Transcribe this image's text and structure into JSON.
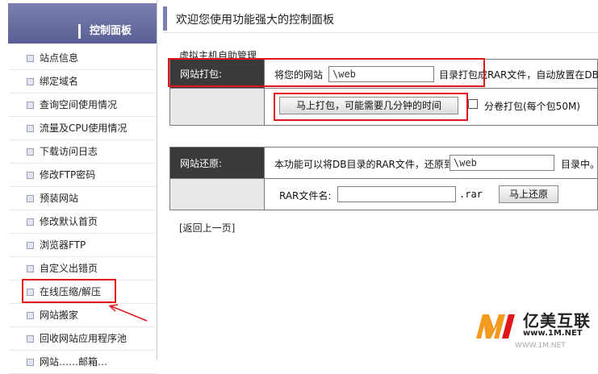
{
  "sidebar": {
    "title": "控制面板",
    "items": [
      {
        "label": "站点信息"
      },
      {
        "label": "绑定域名"
      },
      {
        "label": "查询空间使用情况"
      },
      {
        "label": "流量及CPU使用情况"
      },
      {
        "label": "下载访问日志"
      },
      {
        "label": "修改FTP密码"
      },
      {
        "label": "预装网站"
      },
      {
        "label": "修改默认首页"
      },
      {
        "label": "浏览器FTP"
      },
      {
        "label": "自定义出错页"
      },
      {
        "label": "在线压缩/解压"
      },
      {
        "label": "网站搬家"
      },
      {
        "label": "回收网站应用程序池"
      },
      {
        "label": "网站……邮箱…"
      }
    ]
  },
  "main": {
    "title": "欢迎您使用功能强大的控制面板",
    "section_title": "虚拟主机自助管理",
    "pack": {
      "label": "网站打包:",
      "prefix_text": "将您的网站",
      "path_value": "\\web",
      "suffix_text": "目录打包成RAR文件，自动放置在DB目",
      "button_label": "马上打包，可能需要几分钟的时间",
      "split_label": "分卷打包(每个包50M)"
    },
    "restore": {
      "label": "网站还原:",
      "prefix_text": "本功能可以将DB目录的RAR文件，还原到",
      "path_value": "\\web",
      "suffix_text": "目录中。",
      "file_label": "RAR文件名:",
      "file_value": "",
      "ext_text": ".rar",
      "button_label": "马上还原"
    },
    "back_link": "[返回上一页]"
  },
  "watermark": {
    "name": "亿美互联",
    "url": "www.1M.NET",
    "url2": "WWW.1M.NET"
  },
  "colors": {
    "sidebar_header": "#5a5f95",
    "highlight": "#e2151b",
    "dark_cell": "#3a3a3a"
  }
}
